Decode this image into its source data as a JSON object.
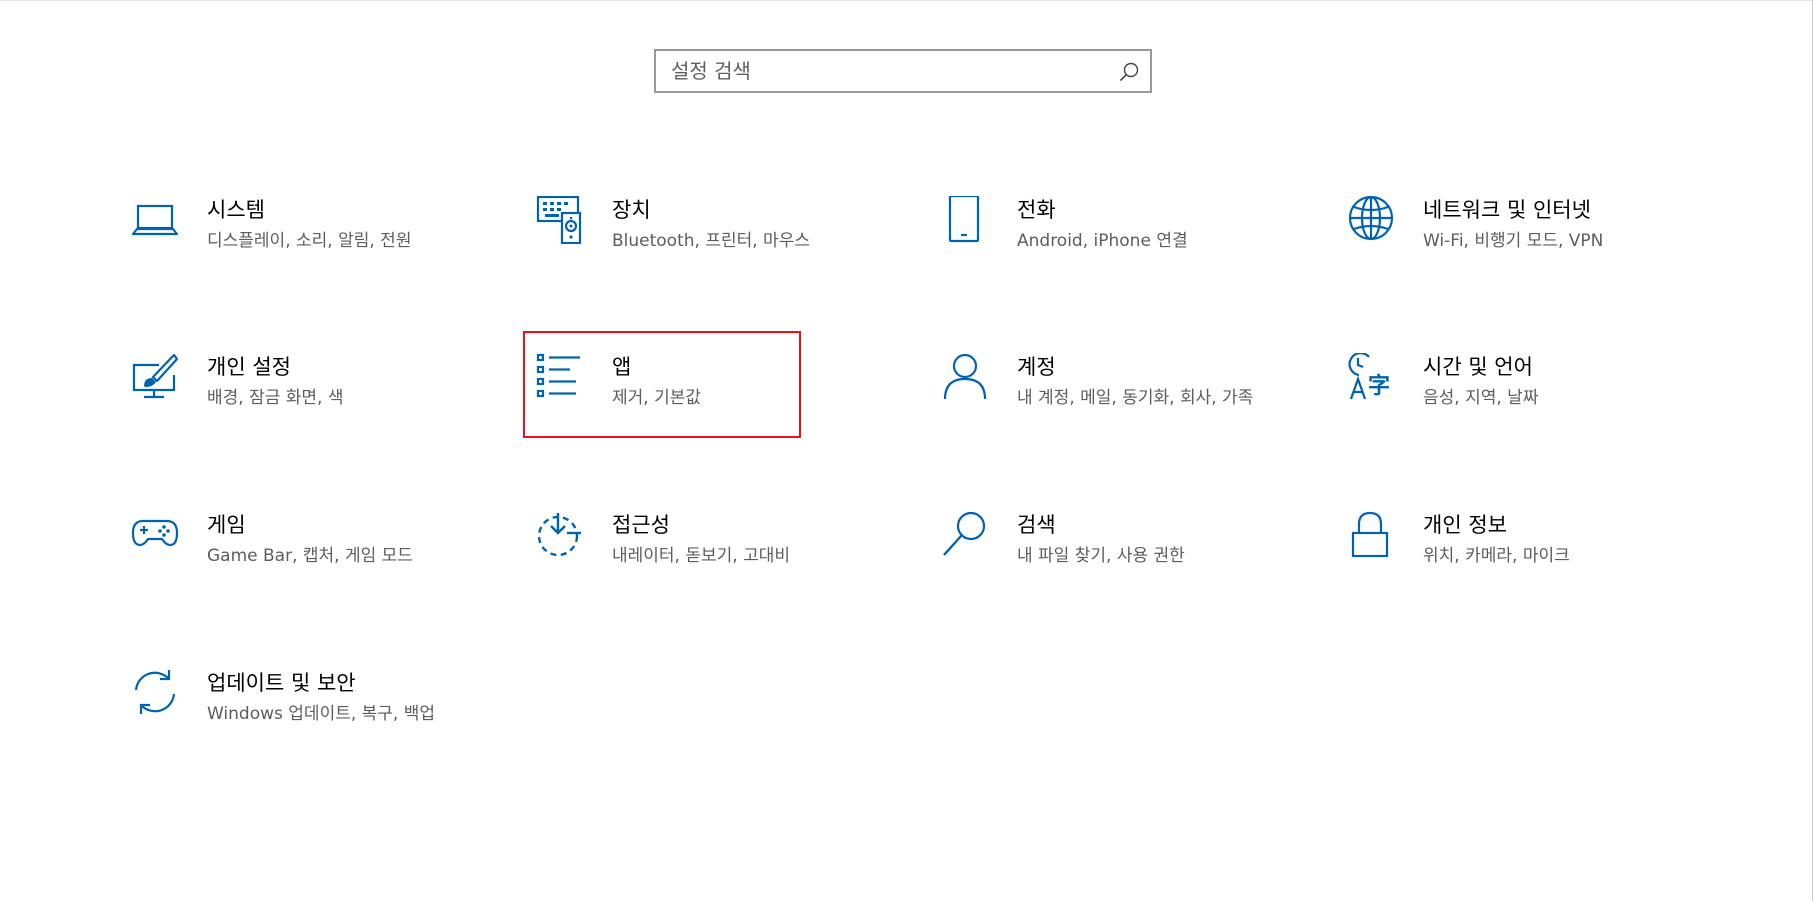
{
  "search": {
    "placeholder": "설정 검색"
  },
  "colors": {
    "accent": "#0063b1",
    "highlight": "#e81123",
    "description": "#5d5d5d"
  },
  "tiles": [
    {
      "title": "시스템",
      "desc": "디스플레이, 소리, 알림, 전원",
      "icon": "laptop-icon"
    },
    {
      "title": "장치",
      "desc": "Bluetooth, 프린터, 마우스",
      "icon": "devices-icon"
    },
    {
      "title": "전화",
      "desc": "Android, iPhone 연결",
      "icon": "phone-icon"
    },
    {
      "title": "네트워크 및 인터넷",
      "desc": "Wi-Fi, 비행기 모드, VPN",
      "icon": "globe-icon"
    },
    {
      "title": "개인 설정",
      "desc": "배경, 잠금 화면, 색",
      "icon": "personalization-icon"
    },
    {
      "title": "앱",
      "desc": "제거, 기본값",
      "icon": "apps-list-icon"
    },
    {
      "title": "계정",
      "desc": "내 계정, 메일, 동기화, 회사, 가족",
      "icon": "person-icon"
    },
    {
      "title": "시간 및 언어",
      "desc": "음성, 지역, 날짜",
      "icon": "time-language-icon"
    },
    {
      "title": "게임",
      "desc": "Game Bar, 캡처, 게임 모드",
      "icon": "gamepad-icon"
    },
    {
      "title": "접근성",
      "desc": "내레이터, 돋보기, 고대비",
      "icon": "ease-of-access-icon"
    },
    {
      "title": "검색",
      "desc": "내 파일 찾기, 사용 권한",
      "icon": "magnifier-icon"
    },
    {
      "title": "개인 정보",
      "desc": "위치, 카메라, 마이크",
      "icon": "lock-icon"
    },
    {
      "title": "업데이트 및 보안",
      "desc": "Windows 업데이트, 복구, 백업",
      "icon": "sync-icon"
    }
  ]
}
